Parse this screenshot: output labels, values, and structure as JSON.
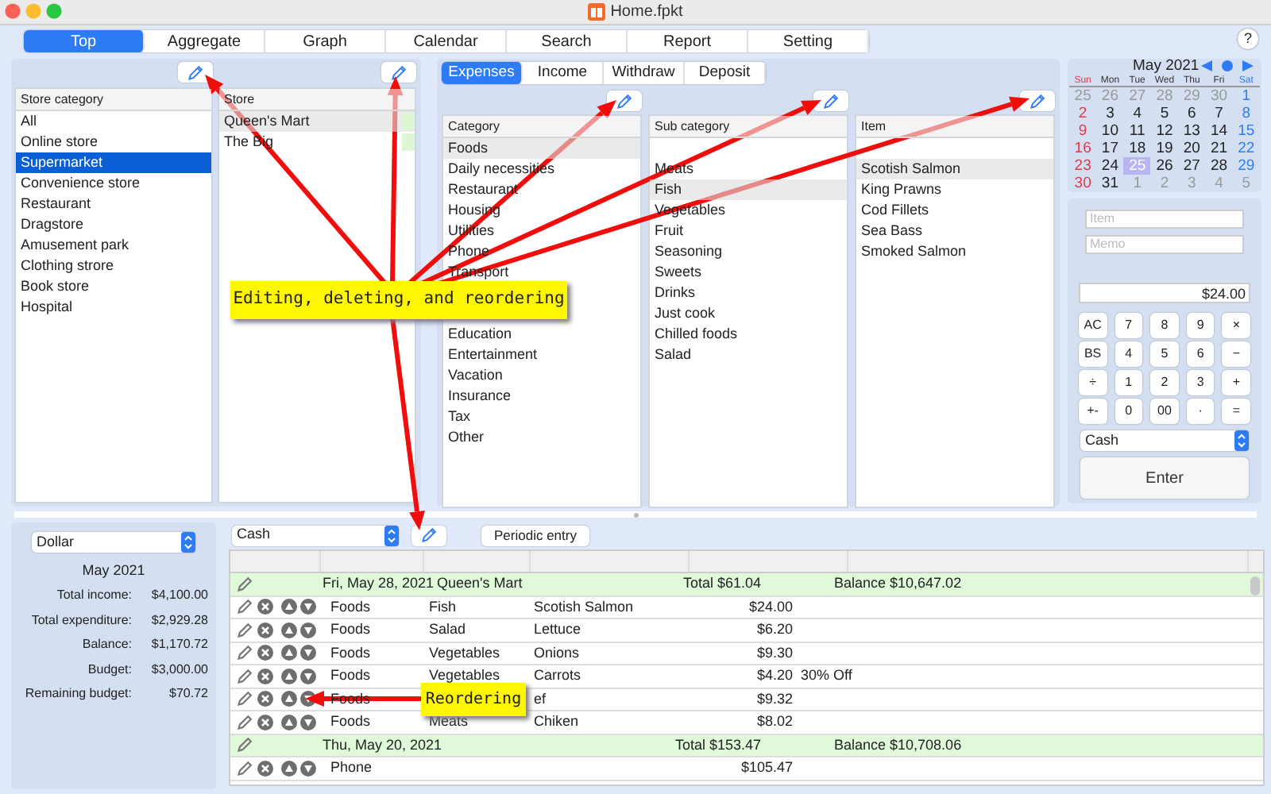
{
  "window": {
    "title": "Home.fpkt"
  },
  "main_tabs": [
    {
      "label": "Top",
      "selected": true
    },
    {
      "label": "Aggregate",
      "selected": false
    },
    {
      "label": "Graph",
      "selected": false
    },
    {
      "label": "Calendar",
      "selected": false
    },
    {
      "label": "Search",
      "selected": false
    },
    {
      "label": "Report",
      "selected": false
    },
    {
      "label": "Setting",
      "selected": false
    }
  ],
  "help_button": "?",
  "store_lists": [
    {
      "header": "Store category",
      "items": [
        {
          "label": "All",
          "selected": false
        },
        {
          "label": "Online store",
          "selected": false
        },
        {
          "label": "Supermarket",
          "selected": true
        },
        {
          "label": "Convenience store",
          "selected": false
        },
        {
          "label": "Restaurant",
          "selected": false
        },
        {
          "label": "Dragstore",
          "selected": false
        },
        {
          "label": "Amusement park",
          "selected": false
        },
        {
          "label": "Clothing strore",
          "selected": false
        },
        {
          "label": "Book store",
          "selected": false
        },
        {
          "label": "Hospital",
          "selected": false
        }
      ]
    },
    {
      "header": "Store",
      "items": [
        {
          "label": "Queen's Mart",
          "selected": true
        },
        {
          "label": "The Big",
          "selected": false
        }
      ]
    }
  ],
  "entry_tabs": [
    {
      "label": "Expenses",
      "selected": true
    },
    {
      "label": "Income",
      "selected": false
    },
    {
      "label": "Withdraw",
      "selected": false
    },
    {
      "label": "Deposit",
      "selected": false
    }
  ],
  "category_lists": [
    {
      "header": "Category",
      "leading_blank_row": false,
      "items_above_callout": [
        {
          "label": "Foods",
          "selected": true
        },
        {
          "label": "Daily necessities",
          "selected": false
        },
        {
          "label": "Restaurant",
          "selected": false
        },
        {
          "label": "Housing",
          "selected": false
        },
        {
          "label": "Utilities",
          "selected": false
        },
        {
          "label": "Phone",
          "selected": false
        },
        {
          "label": "Transport",
          "selected": false
        }
      ],
      "items_below_callout": [
        {
          "label": "Education",
          "selected": false
        },
        {
          "label": "Entertainment",
          "selected": false
        },
        {
          "label": "Vacation",
          "selected": false
        },
        {
          "label": "Insurance",
          "selected": false
        },
        {
          "label": "Tax",
          "selected": false
        },
        {
          "label": "Other",
          "selected": false
        }
      ]
    },
    {
      "header": "Sub category",
      "leading_blank_row": true,
      "items_above_callout": [
        {
          "label": "Meats",
          "selected": false
        },
        {
          "label": "Fish",
          "selected": true
        },
        {
          "label": "Vegetables",
          "selected": false
        },
        {
          "label": "Fruit",
          "selected": false
        },
        {
          "label": "Seasoning",
          "selected": false
        },
        {
          "label": "Sweets",
          "selected": false
        },
        {
          "label": "Drinks",
          "selected": false
        },
        {
          "label": "Just cook",
          "selected": false
        },
        {
          "label": "Chilled foods",
          "selected": false
        },
        {
          "label": "Salad",
          "selected": false
        }
      ]
    },
    {
      "header": "Item",
      "leading_blank_row": true,
      "items_above_callout": [
        {
          "label": "Scotish Salmon",
          "selected": true
        },
        {
          "label": "King Prawns",
          "selected": false
        },
        {
          "label": "Cod Fillets",
          "selected": false
        },
        {
          "label": "Sea Bass",
          "selected": false
        },
        {
          "label": "Smoked Salmon",
          "selected": false
        }
      ]
    }
  ],
  "calendar": {
    "month": "May 2021",
    "weekdays": [
      "Sun",
      "Mon",
      "Tue",
      "Wed",
      "Thu",
      "Fri",
      "Sat"
    ],
    "days": [
      {
        "label": "25",
        "kind": "other",
        "selected": false
      },
      {
        "label": "26",
        "kind": "other",
        "selected": false
      },
      {
        "label": "27",
        "kind": "other",
        "selected": false
      },
      {
        "label": "28",
        "kind": "other",
        "selected": false
      },
      {
        "label": "29",
        "kind": "other",
        "selected": false
      },
      {
        "label": "30",
        "kind": "other",
        "selected": false
      },
      {
        "label": "1",
        "kind": "current",
        "selected": false
      },
      {
        "label": "2",
        "kind": "current",
        "selected": false
      },
      {
        "label": "3",
        "kind": "current",
        "selected": false
      },
      {
        "label": "4",
        "kind": "current",
        "selected": false
      },
      {
        "label": "5",
        "kind": "current",
        "selected": false
      },
      {
        "label": "6",
        "kind": "current",
        "selected": false
      },
      {
        "label": "7",
        "kind": "current",
        "selected": false
      },
      {
        "label": "8",
        "kind": "current",
        "selected": false
      },
      {
        "label": "9",
        "kind": "current",
        "selected": false
      },
      {
        "label": "10",
        "kind": "current",
        "selected": false
      },
      {
        "label": "11",
        "kind": "current",
        "selected": false
      },
      {
        "label": "12",
        "kind": "current",
        "selected": false
      },
      {
        "label": "13",
        "kind": "current",
        "selected": false
      },
      {
        "label": "14",
        "kind": "current",
        "selected": false
      },
      {
        "label": "15",
        "kind": "current",
        "selected": false
      },
      {
        "label": "16",
        "kind": "current",
        "selected": false
      },
      {
        "label": "17",
        "kind": "current",
        "selected": false
      },
      {
        "label": "18",
        "kind": "current",
        "selected": false
      },
      {
        "label": "19",
        "kind": "current",
        "selected": false
      },
      {
        "label": "20",
        "kind": "current",
        "selected": false
      },
      {
        "label": "21",
        "kind": "current",
        "selected": false
      },
      {
        "label": "22",
        "kind": "current",
        "selected": false
      },
      {
        "label": "23",
        "kind": "current",
        "selected": false
      },
      {
        "label": "24",
        "kind": "current",
        "selected": false
      },
      {
        "label": "25",
        "kind": "current",
        "selected": true
      },
      {
        "label": "26",
        "kind": "current",
        "selected": false
      },
      {
        "label": "27",
        "kind": "current",
        "selected": false
      },
      {
        "label": "28",
        "kind": "current",
        "selected": false
      },
      {
        "label": "29",
        "kind": "current",
        "selected": false
      },
      {
        "label": "30",
        "kind": "current",
        "selected": false
      },
      {
        "label": "31",
        "kind": "current",
        "selected": false
      },
      {
        "label": "1",
        "kind": "other",
        "selected": false
      },
      {
        "label": "2",
        "kind": "other",
        "selected": false
      },
      {
        "label": "3",
        "kind": "other",
        "selected": false
      },
      {
        "label": "4",
        "kind": "other",
        "selected": false
      },
      {
        "label": "5",
        "kind": "other",
        "selected": false
      }
    ]
  },
  "entry_form": {
    "item": {
      "placeholder": "Item"
    },
    "memo": {
      "placeholder": "Memo"
    },
    "amount": "$24.00",
    "keys": [
      "AC",
      "7",
      "8",
      "9",
      "×",
      "BS",
      "4",
      "5",
      "6",
      "−",
      "÷",
      "1",
      "2",
      "3",
      "+",
      "+-",
      "0",
      "00",
      "·",
      "="
    ],
    "account": "Cash",
    "enter_button": "Enter"
  },
  "summary": {
    "currency": "Dollar",
    "month": "May 2021",
    "rows": [
      {
        "label": "Total income:",
        "value": "$4,100.00"
      },
      {
        "label": "Total expenditure:",
        "value": "$2,929.28"
      },
      {
        "label": "Balance:",
        "value": "$1,170.72"
      },
      {
        "label": "Budget:",
        "value": "$3,000.00"
      },
      {
        "label": "Remaining budget:",
        "value": "$70.72"
      }
    ]
  },
  "ledger": {
    "account": "Cash",
    "periodic_button": "Periodic entry",
    "groups": [
      {
        "date": "Fri, May 28, 2021",
        "store": "Queen's Mart",
        "total": "Total $61.04",
        "balance": "Balance $10,647.02",
        "entries": [
          {
            "category": "Foods",
            "sub_category": "Fish",
            "item": "Scotish Salmon",
            "amount": "$24.00"
          },
          {
            "category": "Foods",
            "sub_category": "Salad",
            "item": "Lettuce",
            "amount": "$6.20"
          },
          {
            "category": "Foods",
            "sub_category": "Vegetables",
            "item": "Onions",
            "amount": "$9.30"
          },
          {
            "category": "Foods",
            "sub_category": "Vegetables",
            "item": "Carrots",
            "amount": "$4.20",
            "memo": "30% Off"
          },
          {
            "category": "Foods",
            "item": "ef",
            "amount": "$9.32"
          },
          {
            "category": "Foods",
            "sub_category": "Meats",
            "item": "Chiken",
            "amount": "$8.02"
          }
        ]
      },
      {
        "date": "Thu, May 20, 2021",
        "total": "Total $153.47",
        "balance": "Balance $10,708.06",
        "entries": [
          {
            "category": "Phone",
            "amount": "$105.47"
          }
        ]
      }
    ]
  },
  "callouts": [
    {
      "text": "Editing, deleting, and reordering"
    },
    {
      "text": "Reordering"
    }
  ]
}
